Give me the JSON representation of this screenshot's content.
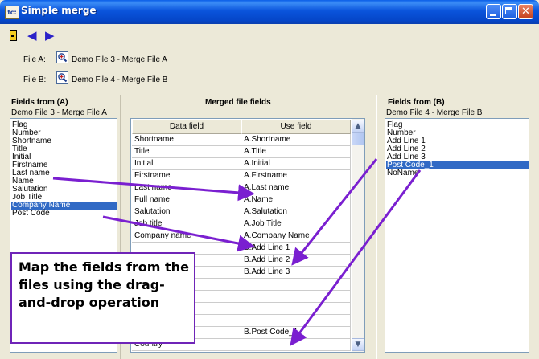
{
  "window": {
    "title": "Simple merge",
    "app_icon_text": "fc:"
  },
  "toolbar": {
    "icons": [
      "exit-door-icon",
      "back-arrow-icon",
      "forward-arrow-icon"
    ]
  },
  "files": {
    "a_label": "File A:",
    "a_name": "Demo File 3 - Merge File A",
    "b_label": "File B:",
    "b_name": "Demo File 4 - Merge File B"
  },
  "left_panel": {
    "header": "Fields from (A)",
    "subtitle": "Demo File 3 - Merge File A",
    "items": [
      "Flag",
      "Number",
      "Shortname",
      "Title",
      "Initial",
      "Firstname",
      "Last name",
      "Name",
      "Salutation",
      "Job Title",
      "Company Name",
      "Post Code"
    ],
    "selected": "Company Name"
  },
  "center_panel": {
    "header": "Merged file fields",
    "columns": [
      "Data field",
      "Use field"
    ],
    "rows": [
      [
        "Shortname",
        "A.Shortname"
      ],
      [
        "Title",
        "A.Title"
      ],
      [
        "Initial",
        "A.Initial"
      ],
      [
        "Firstname",
        "A.Firstname"
      ],
      [
        "Last name",
        "A.Last name"
      ],
      [
        "Full name",
        "A.Name"
      ],
      [
        "Salutation",
        "A.Salutation"
      ],
      [
        "Job title",
        "A.Job Title"
      ],
      [
        "Company name",
        "A.Company Name"
      ],
      [
        "",
        "B.Add Line 1"
      ],
      [
        "",
        "B.Add Line 2"
      ],
      [
        "",
        "B.Add Line 3"
      ],
      [
        "",
        ""
      ],
      [
        "",
        ""
      ],
      [
        "",
        ""
      ],
      [
        "",
        ""
      ],
      [
        "",
        "B.Post Code_1"
      ],
      [
        "Country",
        ""
      ]
    ]
  },
  "right_panel": {
    "header": "Fields from (B)",
    "subtitle": "Demo File 4 - Merge File B",
    "items": [
      "Flag",
      "Number",
      "Add Line 1",
      "Add Line 2",
      "Add Line 3",
      "Post Code_1",
      "NoName"
    ],
    "selected": "Post Code_1"
  },
  "callout": {
    "text": "Map the fields from the files using the drag-and-drop operation"
  },
  "colors": {
    "title_bar": "#0a54dc",
    "selection": "#316ac5",
    "arrow": "#7a1fd0",
    "callout_border": "#6f24b8"
  }
}
